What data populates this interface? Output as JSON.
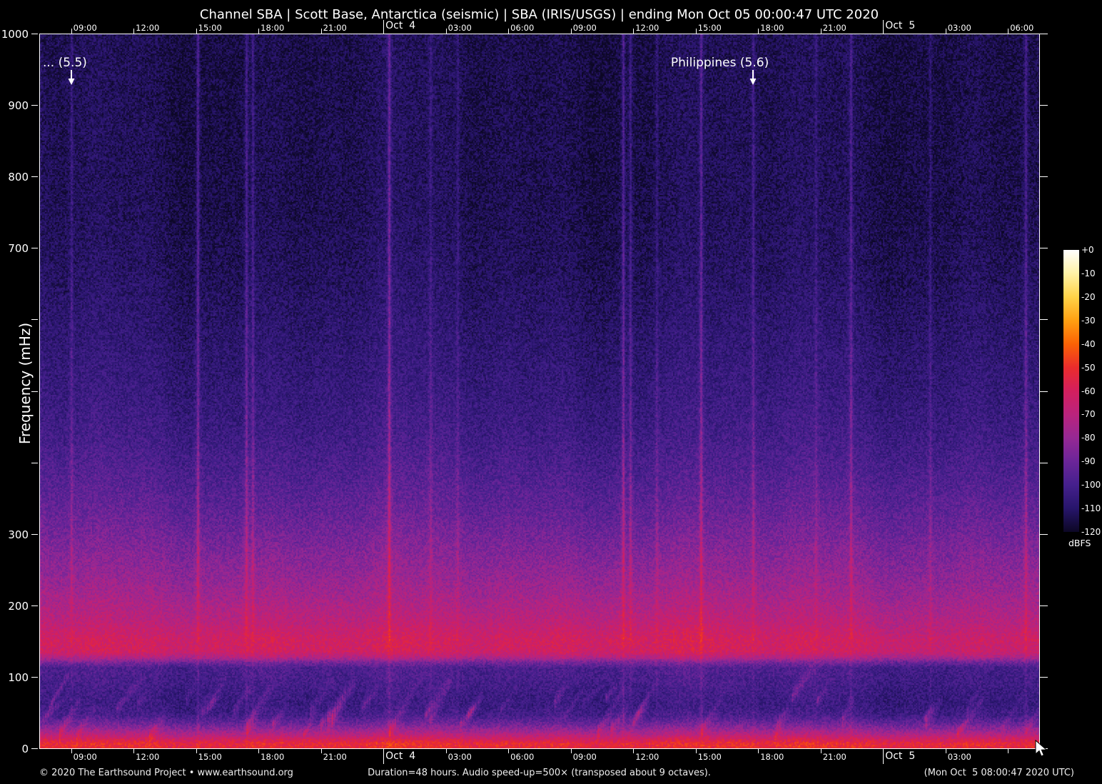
{
  "header": {
    "title": "Channel SBA | Scott Base, Antarctica (seismic) | SBA (IRIS/USGS) | ending Mon Oct 05 00:00:47 UTC 2020"
  },
  "footer": {
    "left": "© 2020 The Earthsound Project • www.earthsound.org",
    "center": "Duration=48 hours. Audio speed-up=500× (transposed about 9 octaves).",
    "right": "(Mon Oct  5 08:00:47 2020 UTC)"
  },
  "chart_data": {
    "type": "heatmap",
    "subtype": "seismic-audio-spectrogram",
    "title": "Channel SBA | Scott Base, Antarctica (seismic) | SBA (IRIS/USGS) | ending Mon Oct 05 00:00:47 UTC 2020",
    "xlabel": "",
    "ylabel": "Frequency (mHz)",
    "ylim": [
      0,
      1000
    ],
    "grid": false,
    "duration_hours": 48.03,
    "y_ticks": [
      {
        "f": 1000,
        "label": "1000"
      },
      {
        "f": 900,
        "label": "900"
      },
      {
        "f": 800,
        "label": "800"
      },
      {
        "f": 700,
        "label": "700"
      },
      {
        "f": 600,
        "label": ""
      },
      {
        "f": 500,
        "label": ""
      },
      {
        "f": 400,
        "label": ""
      },
      {
        "f": 300,
        "label": "300"
      },
      {
        "f": 200,
        "label": "200"
      },
      {
        "f": 100,
        "label": "100"
      },
      {
        "f": 0,
        "label": "0"
      }
    ],
    "x_axis": {
      "span_hours": 48.03,
      "ticks": [
        {
          "h": 1.53,
          "label": "09:00",
          "day": false,
          "bottom_label": true
        },
        {
          "h": 4.53,
          "label": "12:00",
          "day": false,
          "bottom_label": true
        },
        {
          "h": 7.53,
          "label": "15:00",
          "day": false,
          "bottom_label": true
        },
        {
          "h": 10.53,
          "label": "18:00",
          "day": false,
          "bottom_label": true
        },
        {
          "h": 13.53,
          "label": "21:00",
          "day": false,
          "bottom_label": true
        },
        {
          "h": 16.53,
          "label": "Oct  4",
          "day": true,
          "bottom_label": true
        },
        {
          "h": 19.53,
          "label": "03:00",
          "day": false,
          "bottom_label": true
        },
        {
          "h": 22.53,
          "label": "06:00",
          "day": false,
          "bottom_label": true
        },
        {
          "h": 25.53,
          "label": "09:00",
          "day": false,
          "bottom_label": true
        },
        {
          "h": 28.53,
          "label": "12:00",
          "day": false,
          "bottom_label": true
        },
        {
          "h": 31.53,
          "label": "15:00",
          "day": false,
          "bottom_label": true
        },
        {
          "h": 34.53,
          "label": "18:00",
          "day": false,
          "bottom_label": true
        },
        {
          "h": 37.53,
          "label": "21:00",
          "day": false,
          "bottom_label": true
        },
        {
          "h": 40.53,
          "label": "Oct  5",
          "day": true,
          "bottom_label": true
        },
        {
          "h": 43.53,
          "label": "03:00",
          "day": false,
          "bottom_label": true
        },
        {
          "h": 46.53,
          "label": "06:00",
          "day": false,
          "bottom_label": false
        }
      ]
    },
    "annotations": [
      {
        "text": "... (5.5)",
        "h": 1.54
      },
      {
        "text": "Philippines (5.6)",
        "h": 34.29
      }
    ],
    "events": [
      {
        "h": 1.54,
        "db_boost": 8,
        "tail": false
      },
      {
        "h": 7.61,
        "db_boost": 15,
        "tail": false
      },
      {
        "h": 9.94,
        "db_boost": 13,
        "tail": true
      },
      {
        "h": 10.25,
        "db_boost": 10,
        "tail": false
      },
      {
        "h": 16.8,
        "db_boost": 17,
        "tail": true
      },
      {
        "h": 18.79,
        "db_boost": 7,
        "tail": false
      },
      {
        "h": 20.1,
        "db_boost": 6,
        "tail": false
      },
      {
        "h": 28.04,
        "db_boost": 15,
        "tail": false
      },
      {
        "h": 28.39,
        "db_boost": 11,
        "tail": false
      },
      {
        "h": 29.66,
        "db_boost": 7,
        "tail": false
      },
      {
        "h": 31.78,
        "db_boost": 15,
        "tail": true
      },
      {
        "h": 34.29,
        "db_boost": 10,
        "tail": false
      },
      {
        "h": 37.3,
        "db_boost": 6,
        "tail": false
      },
      {
        "h": 38.98,
        "db_boost": 12,
        "tail": false
      },
      {
        "h": 42.79,
        "db_boost": 7,
        "tail": false
      },
      {
        "h": 47.38,
        "db_boost": 12,
        "tail": true
      }
    ],
    "background_profile_db": [
      [
        0,
        -52
      ],
      [
        6,
        -52
      ],
      [
        12,
        -60
      ],
      [
        18,
        -70
      ],
      [
        24,
        -78
      ],
      [
        32,
        -88
      ],
      [
        45,
        -100
      ],
      [
        60,
        -104
      ],
      [
        75,
        -103
      ],
      [
        90,
        -101
      ],
      [
        100,
        -100
      ],
      [
        112,
        -99
      ],
      [
        120,
        -88
      ],
      [
        127,
        -72
      ],
      [
        135,
        -63
      ],
      [
        150,
        -62
      ],
      [
        162,
        -65
      ],
      [
        175,
        -69
      ],
      [
        190,
        -72
      ],
      [
        210,
        -76
      ],
      [
        235,
        -80
      ],
      [
        260,
        -83
      ],
      [
        290,
        -87
      ],
      [
        330,
        -92
      ],
      [
        380,
        -97
      ],
      [
        440,
        -102
      ],
      [
        500,
        -105
      ],
      [
        580,
        -108
      ],
      [
        660,
        -111
      ],
      [
        750,
        -113
      ],
      [
        1000,
        -114
      ]
    ],
    "colorbar": {
      "unit": "dBFS",
      "max_db": 0,
      "min_db": -120,
      "tick_labels": [
        "+0",
        "-10",
        "-20",
        "-30",
        "-40",
        "-50",
        "-60",
        "-70",
        "-80",
        "-90",
        "-100",
        "-110",
        "-120"
      ],
      "stops": [
        [
          0,
          "#ffffff"
        ],
        [
          -10,
          "#fff3a6"
        ],
        [
          -20,
          "#ffd348"
        ],
        [
          -30,
          "#ffa012"
        ],
        [
          -40,
          "#fb6205"
        ],
        [
          -50,
          "#ea2c2c"
        ],
        [
          -60,
          "#d41f5e"
        ],
        [
          -70,
          "#ba237d"
        ],
        [
          -80,
          "#962894"
        ],
        [
          -90,
          "#6b2599"
        ],
        [
          -100,
          "#45208d"
        ],
        [
          -110,
          "#27156b"
        ],
        [
          -120,
          "#0c0724"
        ]
      ]
    }
  }
}
